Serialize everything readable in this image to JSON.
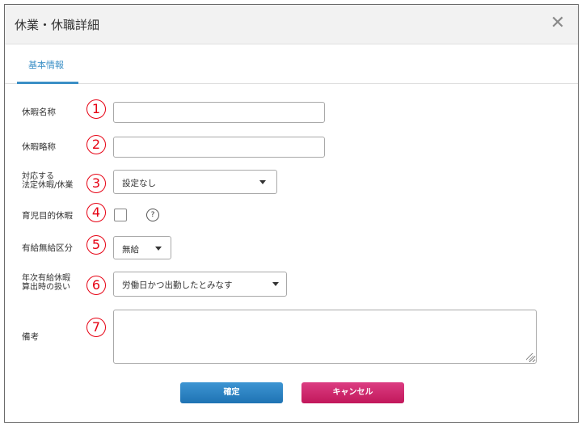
{
  "dialog": {
    "title": "休業・休職詳細",
    "close_glyph": "✕"
  },
  "tabs": [
    {
      "label": "基本情報",
      "active": true
    }
  ],
  "markers": [
    "1",
    "2",
    "3",
    "4",
    "5",
    "6",
    "7"
  ],
  "form": {
    "leave_name": {
      "label": "休暇名称",
      "value": ""
    },
    "leave_abbrev": {
      "label": "休暇略称",
      "value": ""
    },
    "statutory": {
      "label_line1": "対応する",
      "label_line2": "法定休暇/休業",
      "selected": "設定なし"
    },
    "childcare": {
      "label": "育児目的休暇",
      "checked": false,
      "help_glyph": "?"
    },
    "paid_type": {
      "label": "有給無給区分",
      "selected": "無給"
    },
    "annual_leave": {
      "label_line1": "年次有給休暇",
      "label_line2": "算出時の扱い",
      "selected": "労働日かつ出勤したとみなす"
    },
    "notes": {
      "label": "備考",
      "value": ""
    }
  },
  "buttons": {
    "confirm": "確定",
    "cancel": "キャンセル"
  },
  "colors": {
    "accent": "#3b8fc6",
    "marker_red": "#e60012",
    "confirm_blue": "#2a7fc0",
    "cancel_pink": "#d1306f"
  }
}
